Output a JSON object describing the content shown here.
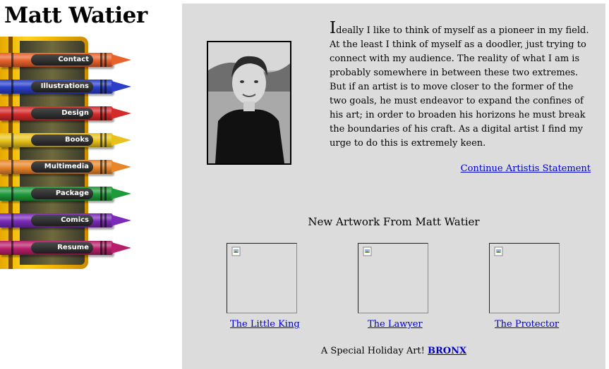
{
  "site": {
    "title": "Matt Watier"
  },
  "nav": {
    "items": [
      {
        "label": "Contact",
        "color": "#e8622a"
      },
      {
        "label": "Illustrations",
        "color": "#2b3fc8"
      },
      {
        "label": "Design",
        "color": "#d42a2a"
      },
      {
        "label": "Books",
        "color": "#e8c21a"
      },
      {
        "label": "Multimedia",
        "color": "#e8862a"
      },
      {
        "label": "Package",
        "color": "#1f9a3a"
      },
      {
        "label": "Comics",
        "color": "#7a2bb8"
      },
      {
        "label": "Resume",
        "color": "#b81f6a"
      }
    ]
  },
  "statement": {
    "dropcap": "I",
    "body": "deally I like to think of myself as a pioneer in my field. At the least I think of myself as a doodler, just trying to connect with my audience. The reality of what I am is probably somewhere in between these two extremes. But if an artist is to move closer to the former of the two goals, he must endeavor to expand the confines of his art; in order to broaden his horizons he must break the boundaries of his craft. As a digital artist I find my urge to do this is extremely keen.",
    "continue_link": "Continue Artistis Statement"
  },
  "artwork": {
    "heading": "New Artwork From Matt Watier",
    "items": [
      {
        "title": "The Little King"
      },
      {
        "title": "The Lawyer"
      },
      {
        "title": "The Protector"
      }
    ]
  },
  "holiday": {
    "text": "A Special Holiday Art!",
    "link": "BRONX"
  }
}
